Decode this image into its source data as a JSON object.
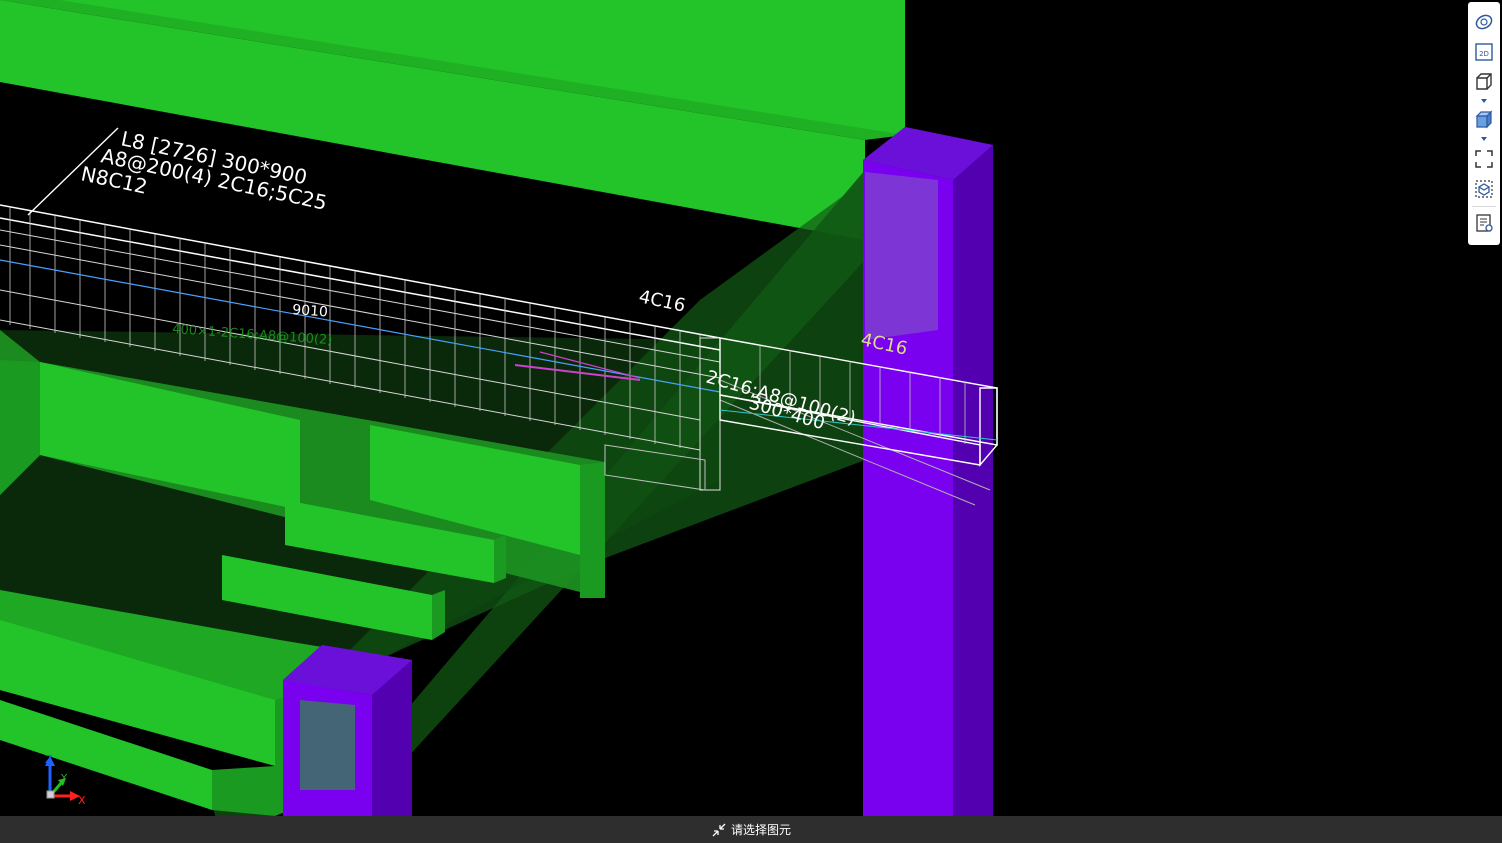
{
  "viewport": {
    "background": "#000000",
    "colors": {
      "slab_green": "#22c42a",
      "slab_green_dark": "#1a9a20",
      "column_purple": "#7a00f0",
      "column_purple_dark": "#5200b0",
      "rebar_white": "#ffffff",
      "annotation_white": "#ffffff",
      "annotation_green": "#1fa81f",
      "annotation_yellow": "#dcdc8a",
      "line_blue": "#4aa0ff",
      "line_magenta": "#d040d0"
    },
    "beam_label": {
      "line1": "L8 [2726] 300*900",
      "line2": "A8@200(4) 2C16;5C25",
      "line3": "N8C12"
    },
    "top_rebar_label": "4C16",
    "column_rebar_label": "4C16",
    "small_beam_label": {
      "line1": "2C16;A8@100(2)",
      "line2": "300*400"
    },
    "faded_label": {
      "line1": "9010",
      "line2": "400×1-2C16;A8@100(2)"
    }
  },
  "toolbar": {
    "items": [
      {
        "name": "orbit-icon",
        "label": "动态观察"
      },
      {
        "name": "2d-view-icon",
        "label": "2D"
      },
      {
        "name": "3d-view-icon",
        "label": "3D"
      },
      {
        "name": "shaded-mode-icon",
        "label": "实体"
      },
      {
        "name": "fullscreen-icon",
        "label": "全屏"
      },
      {
        "name": "component-view-icon",
        "label": "构件"
      },
      {
        "name": "properties-list-icon",
        "label": "属性"
      }
    ]
  },
  "status_bar": {
    "message": "请选择图元",
    "icon": "collapse-arrows-icon"
  },
  "axis_gizmo": {
    "z_label": "Z",
    "y_label": "Y",
    "x_label": "X",
    "z_color": "#2060ff",
    "y_color": "#20c020",
    "x_color": "#ff2020"
  }
}
